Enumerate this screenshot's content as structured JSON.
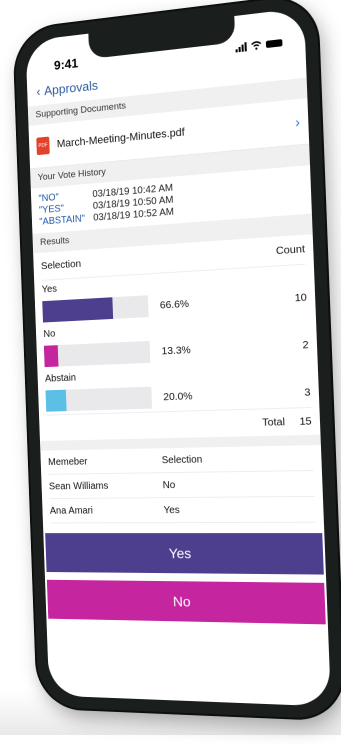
{
  "status": {
    "time": "9:41"
  },
  "nav": {
    "back_label": "Approvals"
  },
  "sections": {
    "supporting_documents": "Supporting Documents",
    "vote_history": "Your Vote History",
    "results": "Results"
  },
  "document": {
    "name": "March-Meeting-Minutes.pdf",
    "icon_text": "PDF"
  },
  "vote_history": [
    {
      "label": "\"NO\"",
      "time": "03/18/19 10:42 AM"
    },
    {
      "label": "\"YES\"",
      "time": "03/18/19 10:50 AM"
    },
    {
      "label": "\"ABSTAIN\"",
      "time": "03/18/19 10:52 AM"
    }
  ],
  "results": {
    "header_selection": "Selection",
    "header_count": "Count",
    "rows": [
      {
        "label": "Yes",
        "percent_text": "66.6%",
        "percent": 66.6,
        "count": "10",
        "color": "#4e3f8e"
      },
      {
        "label": "No",
        "percent_text": "13.3%",
        "percent": 13.3,
        "count": "2",
        "color": "#c5259f"
      },
      {
        "label": "Abstain",
        "percent_text": "20.0%",
        "percent": 20.0,
        "count": "3",
        "color": "#5bbfe6"
      }
    ],
    "total_label": "Total",
    "total_value": "15"
  },
  "members": {
    "header_member": "Memeber",
    "header_selection": "Selection",
    "rows": [
      {
        "name": "Sean Williams",
        "selection": "No"
      },
      {
        "name": "Ana Amari",
        "selection": "Yes"
      }
    ]
  },
  "buttons": {
    "yes_label": "Yes",
    "no_label": "No",
    "yes_color": "#4e3f8e",
    "no_color": "#c5259f"
  }
}
